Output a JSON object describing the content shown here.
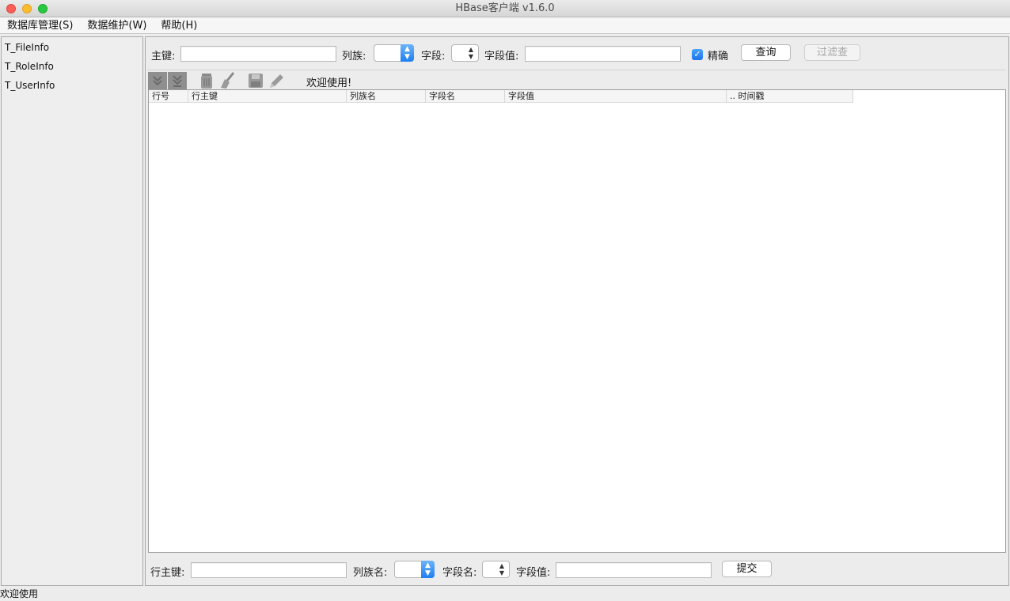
{
  "window": {
    "title": "HBase客户端 v1.6.0"
  },
  "menu": {
    "items": [
      "数据库管理(S)",
      "数据维护(W)",
      "帮助(H)"
    ]
  },
  "tables": [
    "T_FileInfo",
    "T_RoleInfo",
    "T_UserInfo"
  ],
  "query": {
    "rowkey_label": "主键:",
    "family_label": "列族:",
    "field_label": "字段:",
    "value_label": "字段值:",
    "exact_label": "精确",
    "exact_checked": true,
    "query_button": "查询",
    "filter_button": "过滤查"
  },
  "toolbar": {
    "icons": [
      "move-down-icon",
      "move-bottom-icon",
      "delete-icon",
      "clear-broom-icon",
      "save-icon",
      "edit-pencil-icon"
    ],
    "message": "欢迎使用!"
  },
  "grid": {
    "columns": [
      "行号",
      "行主键",
      "列族名",
      "字段名",
      "字段值",
      ".. 时间戳"
    ]
  },
  "submit": {
    "rowkey_label": "行主键:",
    "family_label": "列族名:",
    "field_label": "字段名:",
    "value_label": "字段值:",
    "submit_button": "提交"
  },
  "status": {
    "text": "欢迎使用"
  },
  "colors": {
    "accent": "#1f7ef0",
    "close": "#fc5f57",
    "minimize": "#fdbc2e",
    "maximize": "#28c840"
  }
}
